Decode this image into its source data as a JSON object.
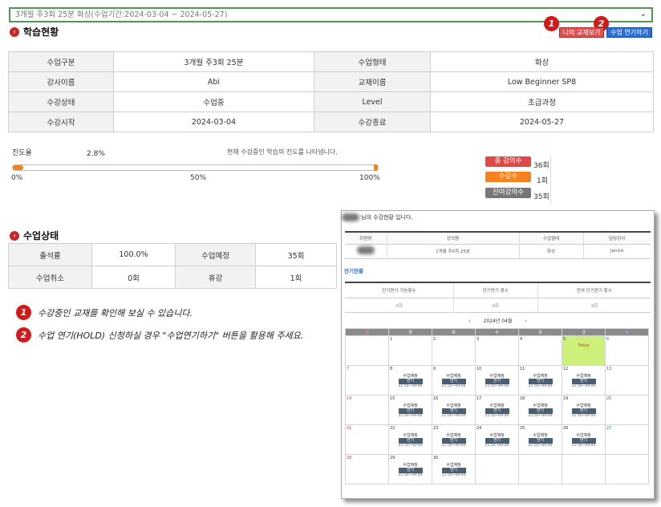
{
  "selector": {
    "value": "3개월 주3회 25분 화상(수업기간:2024-03-04 ~ 2024-05-27)"
  },
  "learning": {
    "title": "학습현황",
    "btn_textbook": "나의 교재보기",
    "btn_hold": "수업 연기하기",
    "marker1": "1",
    "marker2": "2",
    "rows": [
      [
        "수업구분",
        "3개월 주3회 25분",
        "수업형태",
        "화상"
      ],
      [
        "강사이름",
        "Abi",
        "교재이름",
        "Low Beginner SP8"
      ],
      [
        "수강상태",
        "수업중",
        "Level",
        "초급과정"
      ],
      [
        "수강시작",
        "2024-03-04",
        "수강종료",
        "2024-05-27"
      ]
    ]
  },
  "progress": {
    "label": "진도율",
    "value_text": "2.8%",
    "value": 2.8,
    "desc": "현재 수강중인 학습의 진도를 나타냅니다.",
    "ticks": [
      "0%",
      "50%",
      "100%"
    ],
    "fill_color": "#f58220"
  },
  "legend": [
    {
      "label": "총 강의수",
      "value": "36회",
      "color": "#e04848"
    },
    {
      "label": "수강수",
      "value": "1회",
      "color": "#f58220"
    },
    {
      "label": "잔여강의수",
      "value": "35회",
      "color": "#777777"
    }
  ],
  "status": {
    "title": "수업상태",
    "rows": [
      [
        "출석률",
        "100.0%",
        "수업예정",
        "35회"
      ],
      [
        "수업취소",
        "0회",
        "휴강",
        "1회"
      ]
    ]
  },
  "notes": [
    {
      "num": "1",
      "text": "수강중인 교재를 확인해 보실 수 있습니다."
    },
    {
      "num": "2",
      "text": "수업 연기(HOLD) 신청하실 경우 \"수업연기하기\" 버튼을 활용해 주세요."
    }
  ],
  "inset": {
    "greeting": "님의 수강현황 입니다.",
    "headers": [
      "회원명",
      "강의명",
      "수업형태",
      "담당강사"
    ],
    "row": [
      "",
      "1개월 주5회 25분",
      "화상",
      "Janice"
    ],
    "section": "연기현황",
    "hold_headers": [
      "단기연기 가능횟수",
      "단기연기 횟수",
      "잔여 단기연기 횟수"
    ],
    "hold_values": [
      "3회",
      "0회",
      "3회"
    ],
    "month": "2024년 04월",
    "prev": "‹",
    "next": "›",
    "weekdays": [
      "일",
      "월",
      "화",
      "수",
      "목",
      "금",
      "토"
    ],
    "today": "Today",
    "planned": "수업예정",
    "hold_btn": "연기",
    "time": "21:50~09:00"
  }
}
